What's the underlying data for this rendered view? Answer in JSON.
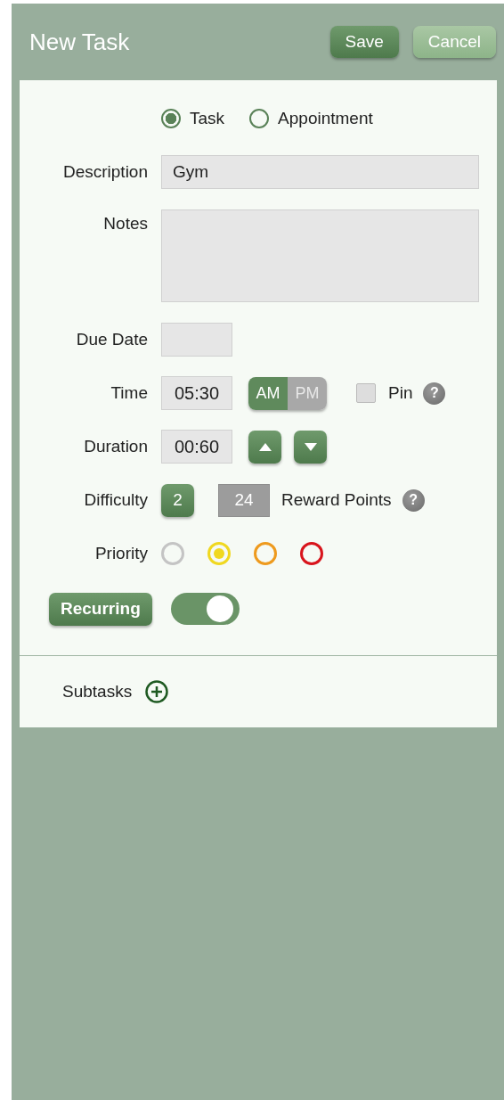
{
  "header": {
    "title": "New Task",
    "buttons": [
      {
        "label": "Save",
        "kind": "primary"
      },
      {
        "label": "Cancel",
        "kind": "secondary"
      }
    ]
  },
  "type_options": [
    {
      "label": "Task",
      "selected": true
    },
    {
      "label": "Appointment",
      "selected": false
    }
  ],
  "description": {
    "label": "Description",
    "value": "Gym"
  },
  "notes": {
    "label": "Notes"
  },
  "due_date": {
    "label": "Due Date"
  },
  "time": {
    "label": "Time",
    "value": "05:30",
    "meridiem": [
      {
        "label": "AM",
        "selected": true
      },
      {
        "label": "PM",
        "selected": false
      }
    ],
    "pin": {
      "label": "Pin",
      "checked": false,
      "help": "?"
    }
  },
  "duration": {
    "label": "Duration",
    "value": "00:60"
  },
  "difficulty": {
    "label": "Difficulty",
    "value": "2",
    "reward_points": "24",
    "reward_label": "Reward Points",
    "help": "?"
  },
  "priority": {
    "label": "Priority",
    "options": [
      {
        "color": "#c4c4c4",
        "selected": false
      },
      {
        "color": "#f0d820",
        "selected": true
      },
      {
        "color": "#ee9a1e",
        "selected": false
      },
      {
        "color": "#d8141c",
        "selected": false
      }
    ]
  },
  "recurring": {
    "label": "Recurring",
    "on": true
  },
  "subtasks": {
    "label": "Subtasks"
  }
}
